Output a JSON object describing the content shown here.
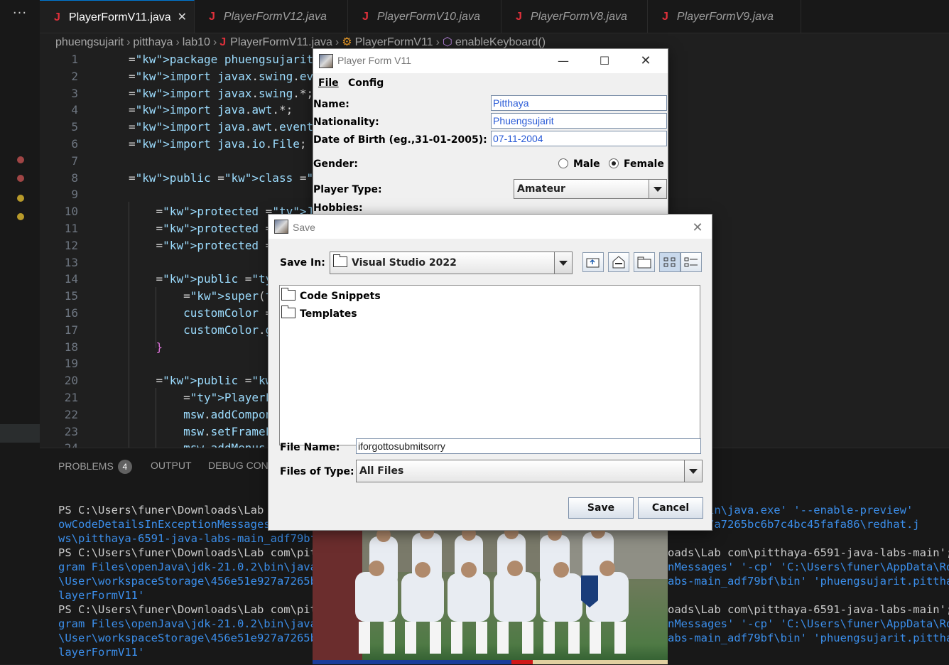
{
  "editor": {
    "tabs": [
      {
        "label": "PlayerFormV11.java",
        "active": true
      },
      {
        "label": "PlayerFormV12.java",
        "active": false
      },
      {
        "label": "PlayerFormV10.java",
        "active": false
      },
      {
        "label": "PlayerFormV8.java",
        "active": false
      },
      {
        "label": "PlayerFormV9.java",
        "active": false
      }
    ],
    "breadcrumb": [
      "phuengsujarit",
      "pitthaya",
      "lab10",
      "PlayerFormV11.java",
      "PlayerFormV11",
      "enableKeyboard()"
    ],
    "line_numbers": [
      "1",
      "2",
      "3",
      "4",
      "5",
      "6",
      "7",
      "8",
      "9",
      "10",
      "11",
      "12",
      "13",
      "14",
      "15",
      "16",
      "17",
      "18",
      "19",
      "20",
      "21",
      "22",
      "23",
      "24"
    ],
    "code_lines": [
      "package phuengsujarit.pitth",
      "import javax.swing.event.*;",
      "import javax.swing.*;",
      "import java.awt.*;",
      "import java.awt.event.*;",
      "import java.io.File;",
      "",
      "public class PlayerFormV11",
      "",
      "    protected JColorChooser",
      "    protected JMenuIt",
      "    protected Color s",
      "",
      "    public PlayerForm",
      "        super(title);",
      "        customColor =",
      "        customColor.g",
      "    }",
      "",
      "    public static voi",
      "        PlayerFormV11",
      "        msw.addCompon",
      "        msw.setFrameF",
      "        msw.addMenus("
    ]
  },
  "panel": {
    "tabs": [
      "PROBLEMS",
      "OUTPUT",
      "DEBUG CONSOLE"
    ],
    "problems_count": "4",
    "terminal_left": [
      "PS C:\\Users\\funer\\Downloads\\Lab c",
      "owCodeDetailsInExceptionMessages'",
      "ws\\pitthaya-6591-java-labs-main_adf79bf\\",
      "PS C:\\Users\\funer\\Downloads\\Lab com\\pitt",
      "gram Files\\openJava\\jdk-21.0.2\\bin\\java.",
      "\\User\\workspaceStorage\\456e51e927a7265bc",
      "layerFormV11'",
      "PS C:\\Users\\funer\\Downloads\\Lab com\\pitt",
      "gram Files\\openJava\\jdk-21.0.2\\bin\\java.",
      "\\User\\workspaceStorage\\456e51e927a7265bc",
      "layerFormV11'"
    ],
    "terminal_right": [
      ".0.2\\bin\\java.exe' '--enable-preview'",
      "e51e927a7265bc6b7c4bc45fafa86\\redhat.j",
      "",
      "oads\\Lab com\\pitthaya-6591-java-labs-main'; &",
      "nMessages' '-cp' 'C:\\Users\\funer\\AppData\\Roam",
      "abs-main_adf79bf\\bin' 'phuengsujarit.pitthaya",
      "",
      "oads\\Lab com\\pitthaya-6591-java-labs-main'; &",
      "nMessages' '-cp' 'C:\\Users\\funer\\AppData\\Roam",
      "abs-main_adf79bf\\bin' 'phuengsujarit.pitthaya",
      ""
    ]
  },
  "player_form": {
    "title": "Player Form V11",
    "menu": [
      "File",
      "Config"
    ],
    "name_label": "Name:",
    "name_value": "Pitthaya",
    "nationality_label": "Nationality:",
    "nationality_value": "Phuengsujarit",
    "dob_label": "Date of Birth (eg.,31-01-2005):",
    "dob_value": "07-11-2004",
    "gender_label": "Gender:",
    "gender_male": "Male",
    "gender_female": "Female",
    "gender_selected": "Female",
    "player_type_label": "Player Type:",
    "player_type_value": "Amateur",
    "hobbies_label": "Hobbies:"
  },
  "save_dialog": {
    "title": "Save",
    "save_in_label": "Save In:",
    "save_in_value": "Visual Studio 2022",
    "files": [
      "Code Snippets",
      "Templates"
    ],
    "file_name_label": "File Name:",
    "file_name_value": "iforgottosubmitsorry",
    "files_of_type_label": "Files of Type:",
    "files_of_type_value": "All Files",
    "save_button": "Save",
    "cancel_button": "Cancel"
  },
  "colors": {
    "editor_bg": "#1f1f1f",
    "keyword": "#569cd6",
    "type": "#4ec9b0",
    "terminal_blue": "#3b8eea",
    "field_text": "#2a5bd7"
  }
}
